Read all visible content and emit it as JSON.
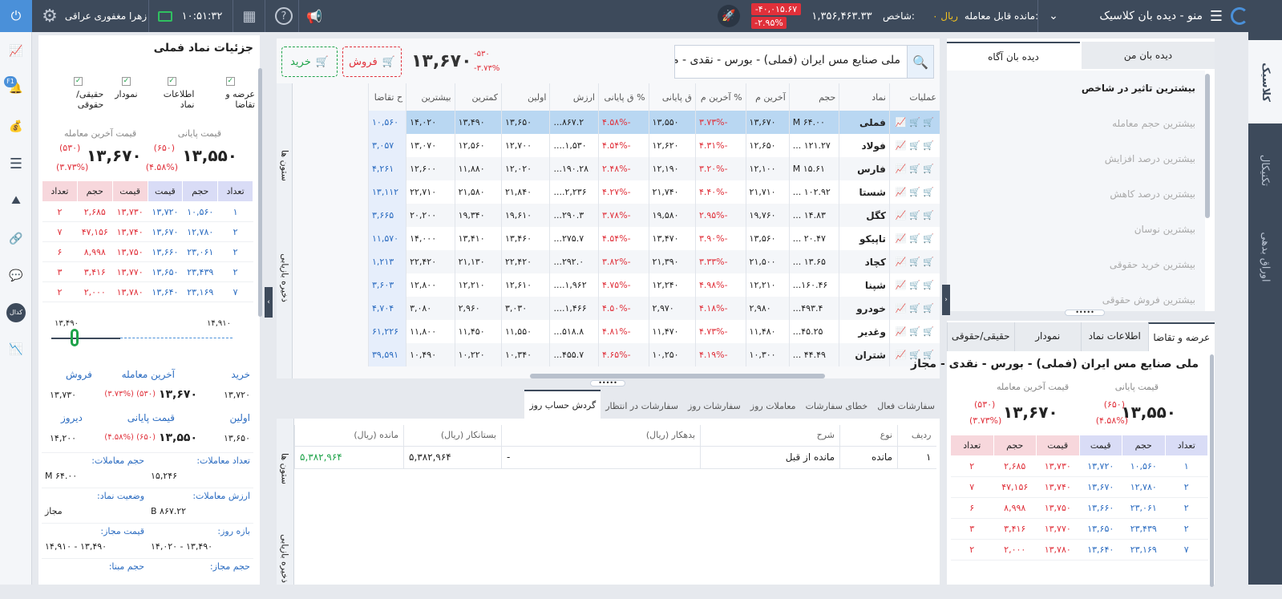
{
  "topbar": {
    "menu_label": "منو - دیده بان کلاسیک",
    "balance_label": "مانده قابل معامله:",
    "balance_value": "۰ ریال",
    "index_label": "شاخص:",
    "index_value": "۱,۳۵۶,۴۶۳.۳۳",
    "index_change": "-۴۰,۰۱۵.۶۷",
    "index_pct": "-۲.۹۵%",
    "clock": "۱۰:۵۱:۳۲",
    "user": "زهرا مغفوری عراقی"
  },
  "right_sidebar": [
    "کلاسیک",
    "تکنیکال",
    "اوراق بدهی"
  ],
  "left_sidebar": {
    "badge": "F1",
    "kdal_label": "کدال"
  },
  "watch_panel": {
    "tabs": [
      "دیده بان من",
      "دیده بان آگاه"
    ],
    "items": [
      "بیشترین تاثیر در شاخص",
      "بیشترین حجم معامله",
      "بیشترین درصد افزایش",
      "بیشترین درصد کاهش",
      "بیشترین نوسان",
      "بیشترین خرید حقوقی",
      "بیشترین فروش حقوقی"
    ]
  },
  "symbol_panel": {
    "tabs": [
      "عرضه و تقاضا",
      "اطلاعات نماد",
      "نمودار",
      "حقیقی/حقوقی"
    ],
    "title": "ملی صنایع مس ایران (فملی) - بورس - نقدی - مجاز",
    "close_label": "قیمت پایانی",
    "close_value": "۱۳,۵۵۰",
    "close_change": "(۶۵۰)",
    "close_pct": "(۴.۵۸%)",
    "last_label": "قیمت آخرین معامله",
    "last_value": "۱۳,۶۷۰",
    "last_change": "(۵۳۰)",
    "last_pct": "(۳.۷۳%)"
  },
  "orderbook": {
    "headers": [
      "تعداد",
      "حجم",
      "قیمت",
      "قیمت",
      "حجم",
      "تعداد"
    ],
    "rows": [
      [
        "۱",
        "۱۰,۵۶۰",
        "۱۳,۷۲۰",
        "۱۳,۷۳۰",
        "۲,۶۸۵",
        "۲"
      ],
      [
        "۲",
        "۱۲,۷۸۰",
        "۱۳,۶۷۰",
        "۱۳,۷۴۰",
        "۴۷,۱۵۶",
        "۷"
      ],
      [
        "۲",
        "۲۳,۰۶۱",
        "۱۳,۶۶۰",
        "۱۳,۷۵۰",
        "۸,۹۹۸",
        "۶"
      ],
      [
        "۲",
        "۲۳,۴۳۹",
        "۱۳,۶۵۰",
        "۱۳,۷۷۰",
        "۳,۴۱۶",
        "۳"
      ],
      [
        "۷",
        "۲۳,۱۶۹",
        "۱۳,۶۴۰",
        "۱۳,۷۸۰",
        "۲,۰۰۰",
        "۲"
      ]
    ]
  },
  "search": {
    "value": "ملی صنایع مس ایران (فملی) - بورس - نقدی - م"
  },
  "quote": {
    "price": "۱۳,۶۷۰",
    "change": "-۵۳۰",
    "pct": "-۳.۷۳%",
    "sell_label": "فروش",
    "buy_label": "خرید"
  },
  "market_table": {
    "headers": [
      "عملیات",
      "نماد",
      "حجم",
      "آخرین م",
      "% آخرین م",
      "ق پایانی",
      "% ق پایانی",
      "ارزش",
      "اولین",
      "کمترین",
      "بیشترین",
      "ح تقاضا"
    ],
    "side_labels": [
      "ستون ها",
      "ذخیره بازیابی"
    ],
    "rows": [
      [
        "فملی",
        "۶۴.۰۰ M",
        "۱۳,۶۷۰",
        "-۳.۷۳%",
        "۱۳,۵۵۰",
        "-۴.۵۸%",
        "۸۶۷.۲...",
        "۱۳,۶۵۰",
        "۱۳,۴۹۰",
        "۱۴,۰۲۰",
        "۱۰,۵۶۰"
      ],
      [
        "فولاد",
        "۱۲۱.۲۷ ...",
        "۱۲,۶۵۰",
        "-۴.۳۱%",
        "۱۲,۶۲۰",
        "-۴.۵۴%",
        "۱,۵۳۰....",
        "۱۲,۷۰۰",
        "۱۲,۵۶۰",
        "۱۳,۰۷۰",
        "۳,۰۵۷"
      ],
      [
        "فارس",
        "۱۵.۶۱ M",
        "۱۲,۱۰۰",
        "-۳.۲۰%",
        "۱۲,۱۹۰",
        "-۲.۴۸%",
        "۱۹۰.۲۸...",
        "۱۲,۰۲۰",
        "۱۱,۸۸۰",
        "۱۲,۶۰۰",
        "۴,۲۶۱"
      ],
      [
        "شستا",
        "۱۰۲.۹۲ ...",
        "۲۱,۷۱۰",
        "-۴.۴۰%",
        "۲۱,۷۴۰",
        "-۴.۲۷%",
        "۲,۲۳۶....",
        "۲۱,۸۴۰",
        "۲۱,۵۸۰",
        "۲۲,۷۱۰",
        "۱۳,۱۱۲"
      ],
      [
        "کگل",
        "۱۴.۸۳ ...",
        "۱۹,۷۶۰",
        "-۲.۹۵%",
        "۱۹,۵۸۰",
        "-۳.۷۸%",
        "۲۹۰.۳...",
        "۱۹,۶۱۰",
        "۱۹,۳۴۰",
        "۲۰,۲۰۰",
        "۳,۶۶۵"
      ],
      [
        "تاپیکو",
        "۲۰.۴۷ ...",
        "۱۳,۵۶۰",
        "-۳.۹۰%",
        "۱۳,۴۷۰",
        "-۴.۵۴%",
        "۲۷۵.۷...",
        "۱۳,۴۶۰",
        "۱۳,۴۱۰",
        "۱۴,۰۰۰",
        "۱۱,۵۷۰"
      ],
      [
        "کچاد",
        "۱۳.۶۵ ...",
        "۲۱,۵۰۰",
        "-۳.۳۳%",
        "۲۱,۳۹۰",
        "-۳.۸۲%",
        "۲۹۲.۰...",
        "۲۲,۴۲۰",
        "۲۱,۱۳۰",
        "۲۲,۴۲۰",
        "۱,۲۱۳"
      ],
      [
        "شپنا",
        "۱۶۰.۴۶...",
        "۱۲,۲۱۰",
        "-۴.۹۸%",
        "۱۲,۲۴۰",
        "-۴.۷۵%",
        "۱,۹۶۲....",
        "۱۲,۶۱۰",
        "۱۲,۲۱۰",
        "۱۲,۸۰۰",
        "۳,۶۰۳"
      ],
      [
        "خودرو",
        "۴۹۳.۴...",
        "۲,۹۸۰",
        "-۴.۱۸%",
        "۲,۹۷۰",
        "-۴.۵۰%",
        "۱,۴۶۶....",
        "۳,۰۳۰",
        "۲,۹۶۰",
        "۳,۰۸۰",
        "۴,۷۰۴"
      ],
      [
        "وغدیر",
        "۴۵.۲۵...",
        "۱۱,۴۸۰",
        "-۴.۷۳%",
        "۱۱,۴۷۰",
        "-۴.۸۱%",
        "۵۱۸.۸...",
        "۱۱,۵۵۰",
        "۱۱,۴۵۰",
        "۱۱,۸۰۰",
        "۶۱,۲۲۶"
      ],
      [
        "شتران",
        "۴۴.۴۹ ...",
        "۱۰,۳۰۰",
        "-۴.۱۹%",
        "۱۰,۲۵۰",
        "-۴.۶۵%",
        "۴۵۵.۷...",
        "۱۰,۳۴۰",
        "۱۰,۲۲۰",
        "۱۰,۴۹۰",
        "۳۹,۵۹۱"
      ]
    ]
  },
  "order_tabs": [
    "سفارشات فعال",
    "خطای سفارشات",
    "معاملات روز",
    "سفارشات روز",
    "سفارشات در انتظار",
    "گردش حساب روز"
  ],
  "account_table": {
    "headers": [
      "ردیف",
      "نوع",
      "شرح",
      "بدهکار (ریال)",
      "بستانکار (ریال)",
      "مانده (ریال)"
    ],
    "rows": [
      [
        "۱",
        "مانده",
        "مانده از قبل",
        "-",
        "۵,۳۸۲,۹۶۴",
        "۵,۳۸۲,۹۶۴"
      ]
    ]
  },
  "details": {
    "title": "جزئیات نماد فملی",
    "checks": [
      "عرضه و تقاضا",
      "اطلاعات نماد",
      "نمودار",
      "حقیقی/حقوقی"
    ],
    "close_label": "قیمت پایانی",
    "close_value": "۱۳,۵۵۰",
    "close_change": "(۶۵۰)",
    "close_pct": "(۴.۵۸%)",
    "last_label": "قیمت آخرین معامله",
    "last_value": "۱۳,۶۷۰",
    "last_change": "(۵۳۰)",
    "last_pct": "(۳.۷۳%)",
    "range_low": "۱۳,۴۹۰",
    "range_high": "۱۴,۹۱۰",
    "buy_label": "خرید",
    "buy_value": "۱۳,۷۲۰",
    "sell_label": "فروش",
    "sell_value": "۱۳,۷۳۰",
    "last_trade_label": "آخرین معامله",
    "last_trade_value": "۱۳,۶۷۰",
    "last_trade_change": "(۵۳۰) (۳.۷۳%)",
    "first_label": "اولین",
    "first_value": "۱۳,۶۵۰",
    "final_label": "قیمت پایانی",
    "final_value": "۱۳,۵۵۰",
    "final_change": "(۶۵۰) (۴.۵۸%)",
    "yesterday_label": "دیروز",
    "yesterday_value": "۱۴,۲۰۰",
    "info": [
      [
        "تعداد معاملات:",
        "۱۵,۲۴۶",
        "حجم معاملات:",
        "۶۴.۰۰ M"
      ],
      [
        "ارزش معاملات:",
        "۸۶۷.۲۲ B",
        "وضعیت نماد:",
        "مجاز"
      ],
      [
        "بازه روز:",
        "۱۳,۴۹۰ - ۱۴,۰۲۰",
        "قیمت مجاز:",
        "۱۳,۴۹۰ - ۱۴,۹۱۰"
      ],
      [
        "حجم مجاز:",
        "",
        "حجم مبنا:",
        ""
      ]
    ]
  }
}
